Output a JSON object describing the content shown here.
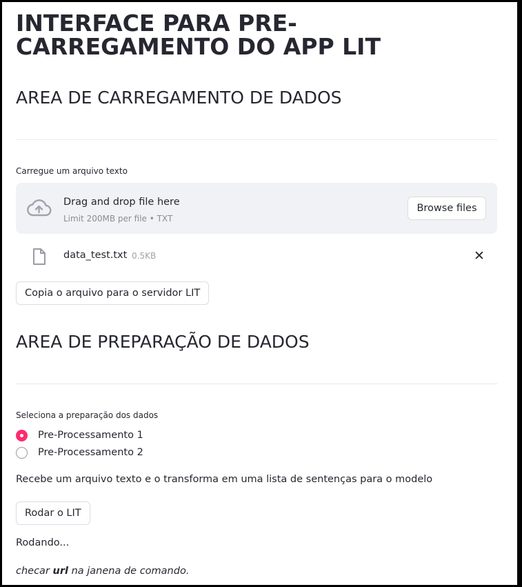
{
  "title": "INTERFACE PARA PRE-CARREGAMENTO DO APP LIT",
  "upload_section": {
    "heading": "AREA DE CARREGAMENTO DE DADOS",
    "uploader_label": "Carregue um arquivo texto",
    "dropzone": {
      "title": "Drag and drop file here",
      "subtitle": "Limit 200MB per file • TXT",
      "browse_label": "Browse files",
      "icon": "cloud-upload-icon"
    },
    "file": {
      "name": "data_test.txt",
      "size": "0.5KB",
      "icon": "file-icon",
      "remove_symbol": "✕"
    },
    "copy_button": "Copia o arquivo para o servidor LIT"
  },
  "prep_section": {
    "heading": "AREA DE PREPARAÇÃO DE DADOS",
    "radio_label": "Seleciona a preparação dos dados",
    "options": [
      "Pre-Processamento 1",
      "Pre-Processamento 2"
    ],
    "selected": 0,
    "description": "Recebe um arquivo texto e o transforma em uma lista de sentenças para o modelo",
    "run_button": "Rodar o LIT",
    "status": "Rodando...",
    "hint": {
      "before": "checar ",
      "bold": "url",
      "after": " na janena de comando."
    }
  },
  "colors": {
    "accent": "#ff2b6e",
    "text": "#262730",
    "dropzone_bg": "#f0f2f6"
  }
}
